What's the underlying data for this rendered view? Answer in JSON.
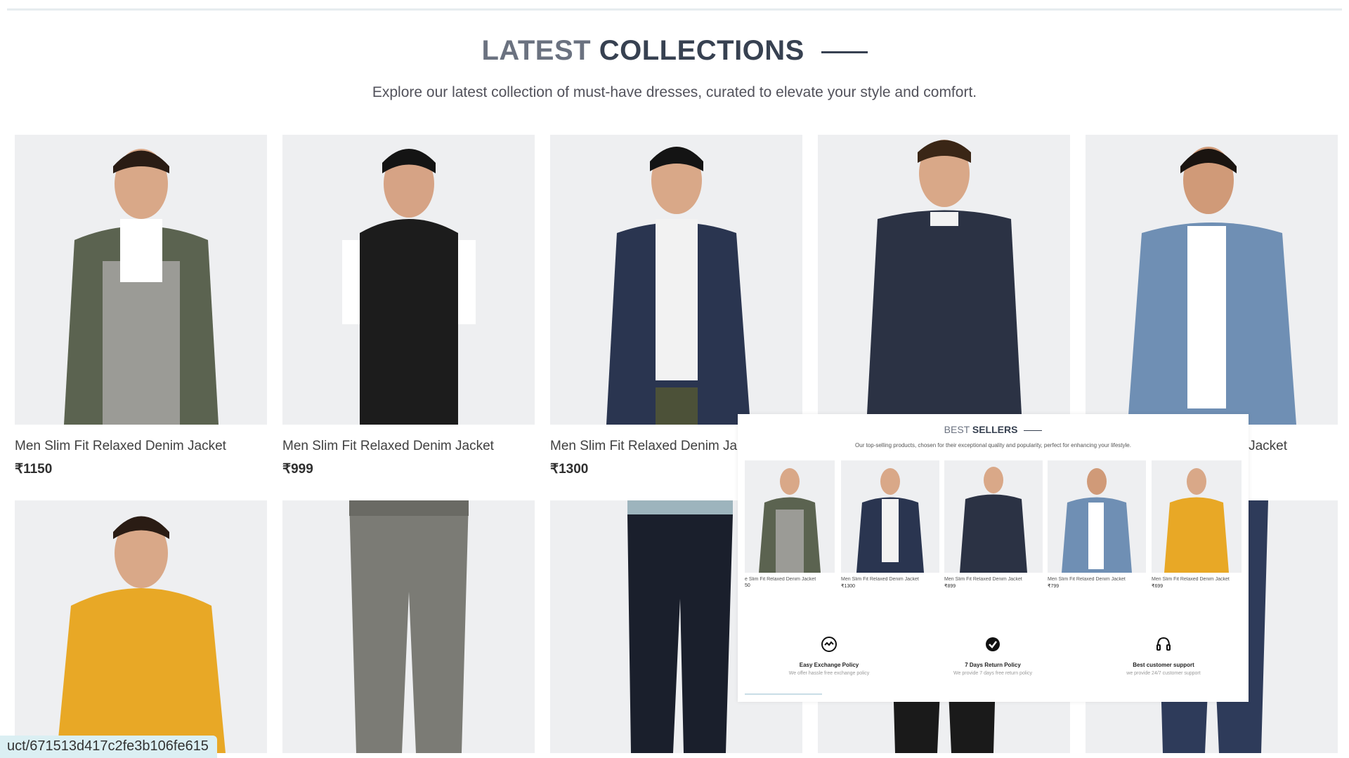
{
  "section": {
    "title_light": "LATEST",
    "title_bold": "COLLECTIONS",
    "subtitle": "Explore our latest collection of must-have dresses, curated to elevate your style and comfort."
  },
  "products": [
    {
      "name": "Men Slim Fit Relaxed Denim Jacket",
      "price": "₹1150",
      "color": "#5b6350"
    },
    {
      "name": "Men Slim Fit Relaxed Denim Jacket",
      "price": "₹999",
      "color": "#1c1c1c"
    },
    {
      "name": "Men Slim Fit Relaxed Denim Jacket",
      "price": "₹1300",
      "color": "#2a3550"
    },
    {
      "name": "",
      "price": "",
      "color": "#2b3244"
    },
    {
      "name": "Jacket",
      "price": "",
      "color": "#6f8fb4"
    }
  ],
  "products_row2": [
    {
      "color": "#e8a826"
    },
    {
      "color": "#7b7b75"
    },
    {
      "color": "#1a1f2c"
    },
    {
      "color": "#1a1a1a"
    },
    {
      "color": "#2e3b5a"
    }
  ],
  "status_url": "uct/671513d417c2fe3b106fe615",
  "best_sellers": {
    "title_light": "BEST",
    "title_bold": "SELLERS",
    "subtitle": "Our top-selling products, chosen for their exceptional quality and popularity, perfect for enhancing your lifestyle.",
    "items": [
      {
        "name": "e Slim Fit Relaxed Denim Jacket",
        "price": "50",
        "color": "#5b6350"
      },
      {
        "name": "Men Slim Fit Relaxed Denim Jacket",
        "price": "₹1300",
        "color": "#2a3550"
      },
      {
        "name": "Men Slim Fit Relaxed Denim Jacket",
        "price": "₹899",
        "color": "#2b3244"
      },
      {
        "name": "Men Slim Fit Relaxed Denim Jacket",
        "price": "₹799",
        "color": "#6f8fb4"
      },
      {
        "name": "Men Slim Fit Relaxed Denim Jacket",
        "price": "₹699",
        "color": "#e8a826"
      }
    ],
    "policies": [
      {
        "icon": "exchange-icon",
        "title": "Easy Exchange Policy",
        "desc": "We offer hassle free exchange policy"
      },
      {
        "icon": "check-badge-icon",
        "title": "7 Days Return Policy",
        "desc": "We provide 7 days free return policy"
      },
      {
        "icon": "headset-icon",
        "title": "Best customer support",
        "desc": "we provide 24/7 customer support"
      }
    ]
  }
}
